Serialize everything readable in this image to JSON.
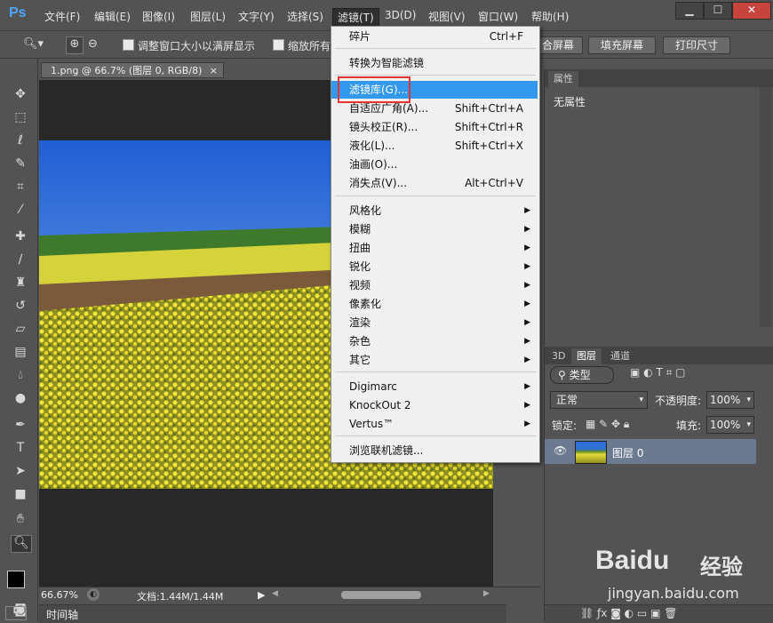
{
  "app": {
    "logo": "Ps"
  },
  "menubar": [
    "文件(F)",
    "编辑(E)",
    "图像(I)",
    "图层(L)",
    "文字(Y)",
    "选择(S)",
    "滤镜(T)",
    "3D(D)",
    "视图(V)",
    "窗口(W)",
    "帮助(H)"
  ],
  "window_controls": {
    "minimize": "▁",
    "maximize": "☐",
    "close": "✕"
  },
  "options": {
    "check1": "调整窗口大小以满屏显示",
    "check2": "缩放所有",
    "buttons": [
      "适合屏幕",
      "填充屏幕",
      "打印尺寸"
    ],
    "btn1_partial": "合屏幕"
  },
  "document": {
    "tab": "1.png @ 66.7% (图层 0, RGB/8)",
    "tab_close": "×",
    "zoom": "66.67%",
    "doc_size": "文档:1.44M/1.44M"
  },
  "timeline_label": "时间轴",
  "properties": {
    "title": "属性",
    "empty": "无属性"
  },
  "layers": {
    "tabs": [
      "3D",
      "图层",
      "通道"
    ],
    "filter_kind": "类型",
    "blend_mode": "正常",
    "opacity_label": "不透明度:",
    "opacity": "100%",
    "lock_label": "锁定:",
    "fill_label": "填充:",
    "fill": "100%",
    "layer_name": "图层 0"
  },
  "filter_menu": {
    "items": [
      {
        "label": "碎片",
        "shortcut": "Ctrl+F"
      },
      {
        "label": "转换为智能滤镜",
        "shortcut": ""
      },
      {
        "label": "滤镜库(G)...",
        "shortcut": ""
      },
      {
        "label": "自适应广角(A)...",
        "shortcut": "Shift+Ctrl+A"
      },
      {
        "label": "镜头校正(R)...",
        "shortcut": "Shift+Ctrl+R"
      },
      {
        "label": "液化(L)...",
        "shortcut": "Shift+Ctrl+X"
      },
      {
        "label": "油画(O)...",
        "shortcut": ""
      },
      {
        "label": "消失点(V)...",
        "shortcut": "Alt+Ctrl+V"
      },
      {
        "label": "风格化"
      },
      {
        "label": "模糊"
      },
      {
        "label": "扭曲"
      },
      {
        "label": "锐化"
      },
      {
        "label": "视频"
      },
      {
        "label": "像素化"
      },
      {
        "label": "渲染"
      },
      {
        "label": "杂色"
      },
      {
        "label": "其它"
      },
      {
        "label": "Digimarc"
      },
      {
        "label": "KnockOut 2"
      },
      {
        "label": "Vertus™"
      },
      {
        "label": "浏览联机滤镜..."
      }
    ]
  },
  "watermark": {
    "brand": "Baidu",
    "cn": "经验",
    "url": "jingyan.baidu.com"
  },
  "colors": {
    "accent": "#3399ee",
    "highlight_box": "#e53333",
    "ui_bg": "#535353"
  }
}
